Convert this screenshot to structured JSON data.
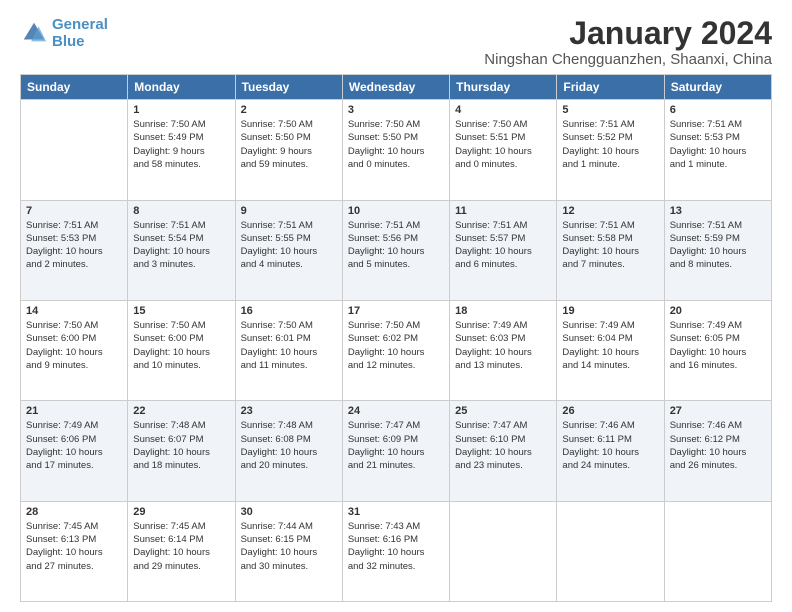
{
  "header": {
    "logo_line1": "General",
    "logo_line2": "Blue",
    "month": "January 2024",
    "location": "Ningshan Chengguanzhen, Shaanxi, China"
  },
  "days_of_week": [
    "Sunday",
    "Monday",
    "Tuesday",
    "Wednesday",
    "Thursday",
    "Friday",
    "Saturday"
  ],
  "weeks": [
    [
      {
        "day": "",
        "info": ""
      },
      {
        "day": "1",
        "info": "Sunrise: 7:50 AM\nSunset: 5:49 PM\nDaylight: 9 hours\nand 58 minutes."
      },
      {
        "day": "2",
        "info": "Sunrise: 7:50 AM\nSunset: 5:50 PM\nDaylight: 9 hours\nand 59 minutes."
      },
      {
        "day": "3",
        "info": "Sunrise: 7:50 AM\nSunset: 5:50 PM\nDaylight: 10 hours\nand 0 minutes."
      },
      {
        "day": "4",
        "info": "Sunrise: 7:50 AM\nSunset: 5:51 PM\nDaylight: 10 hours\nand 0 minutes."
      },
      {
        "day": "5",
        "info": "Sunrise: 7:51 AM\nSunset: 5:52 PM\nDaylight: 10 hours\nand 1 minute."
      },
      {
        "day": "6",
        "info": "Sunrise: 7:51 AM\nSunset: 5:53 PM\nDaylight: 10 hours\nand 1 minute."
      }
    ],
    [
      {
        "day": "7",
        "info": "Sunrise: 7:51 AM\nSunset: 5:53 PM\nDaylight: 10 hours\nand 2 minutes."
      },
      {
        "day": "8",
        "info": "Sunrise: 7:51 AM\nSunset: 5:54 PM\nDaylight: 10 hours\nand 3 minutes."
      },
      {
        "day": "9",
        "info": "Sunrise: 7:51 AM\nSunset: 5:55 PM\nDaylight: 10 hours\nand 4 minutes."
      },
      {
        "day": "10",
        "info": "Sunrise: 7:51 AM\nSunset: 5:56 PM\nDaylight: 10 hours\nand 5 minutes."
      },
      {
        "day": "11",
        "info": "Sunrise: 7:51 AM\nSunset: 5:57 PM\nDaylight: 10 hours\nand 6 minutes."
      },
      {
        "day": "12",
        "info": "Sunrise: 7:51 AM\nSunset: 5:58 PM\nDaylight: 10 hours\nand 7 minutes."
      },
      {
        "day": "13",
        "info": "Sunrise: 7:51 AM\nSunset: 5:59 PM\nDaylight: 10 hours\nand 8 minutes."
      }
    ],
    [
      {
        "day": "14",
        "info": "Sunrise: 7:50 AM\nSunset: 6:00 PM\nDaylight: 10 hours\nand 9 minutes."
      },
      {
        "day": "15",
        "info": "Sunrise: 7:50 AM\nSunset: 6:00 PM\nDaylight: 10 hours\nand 10 minutes."
      },
      {
        "day": "16",
        "info": "Sunrise: 7:50 AM\nSunset: 6:01 PM\nDaylight: 10 hours\nand 11 minutes."
      },
      {
        "day": "17",
        "info": "Sunrise: 7:50 AM\nSunset: 6:02 PM\nDaylight: 10 hours\nand 12 minutes."
      },
      {
        "day": "18",
        "info": "Sunrise: 7:49 AM\nSunset: 6:03 PM\nDaylight: 10 hours\nand 13 minutes."
      },
      {
        "day": "19",
        "info": "Sunrise: 7:49 AM\nSunset: 6:04 PM\nDaylight: 10 hours\nand 14 minutes."
      },
      {
        "day": "20",
        "info": "Sunrise: 7:49 AM\nSunset: 6:05 PM\nDaylight: 10 hours\nand 16 minutes."
      }
    ],
    [
      {
        "day": "21",
        "info": "Sunrise: 7:49 AM\nSunset: 6:06 PM\nDaylight: 10 hours\nand 17 minutes."
      },
      {
        "day": "22",
        "info": "Sunrise: 7:48 AM\nSunset: 6:07 PM\nDaylight: 10 hours\nand 18 minutes."
      },
      {
        "day": "23",
        "info": "Sunrise: 7:48 AM\nSunset: 6:08 PM\nDaylight: 10 hours\nand 20 minutes."
      },
      {
        "day": "24",
        "info": "Sunrise: 7:47 AM\nSunset: 6:09 PM\nDaylight: 10 hours\nand 21 minutes."
      },
      {
        "day": "25",
        "info": "Sunrise: 7:47 AM\nSunset: 6:10 PM\nDaylight: 10 hours\nand 23 minutes."
      },
      {
        "day": "26",
        "info": "Sunrise: 7:46 AM\nSunset: 6:11 PM\nDaylight: 10 hours\nand 24 minutes."
      },
      {
        "day": "27",
        "info": "Sunrise: 7:46 AM\nSunset: 6:12 PM\nDaylight: 10 hours\nand 26 minutes."
      }
    ],
    [
      {
        "day": "28",
        "info": "Sunrise: 7:45 AM\nSunset: 6:13 PM\nDaylight: 10 hours\nand 27 minutes."
      },
      {
        "day": "29",
        "info": "Sunrise: 7:45 AM\nSunset: 6:14 PM\nDaylight: 10 hours\nand 29 minutes."
      },
      {
        "day": "30",
        "info": "Sunrise: 7:44 AM\nSunset: 6:15 PM\nDaylight: 10 hours\nand 30 minutes."
      },
      {
        "day": "31",
        "info": "Sunrise: 7:43 AM\nSunset: 6:16 PM\nDaylight: 10 hours\nand 32 minutes."
      },
      {
        "day": "",
        "info": ""
      },
      {
        "day": "",
        "info": ""
      },
      {
        "day": "",
        "info": ""
      }
    ]
  ]
}
